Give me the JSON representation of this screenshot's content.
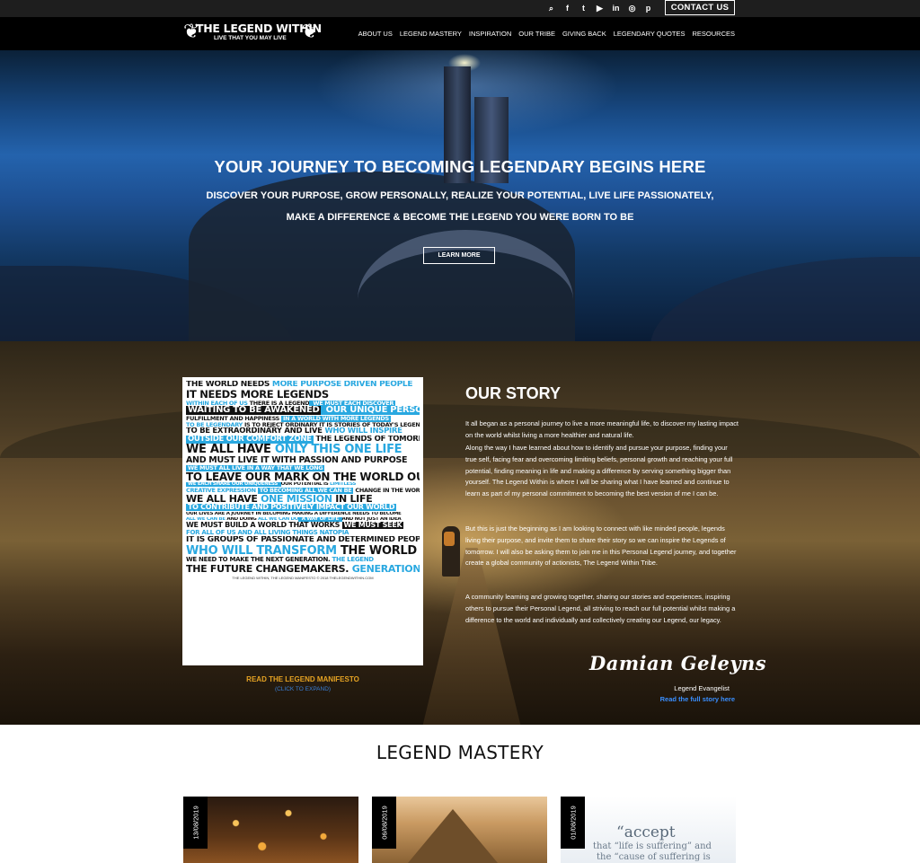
{
  "topbar": {
    "social_icons": [
      "search-icon",
      "facebook-icon",
      "twitter-icon",
      "youtube-icon",
      "linkedin-icon",
      "instagram-icon",
      "pinterest-icon"
    ],
    "social_glyphs": [
      "⌕",
      "f",
      "t",
      "▶",
      "in",
      "◎",
      "p"
    ],
    "contact_label": "CONTACT US"
  },
  "logo": {
    "title": "THE LEGEND WITHIN",
    "tagline": "LIVE THAT YOU MAY LIVE"
  },
  "nav": {
    "items": [
      "ABOUT US",
      "LEGEND MASTERY",
      "INSPIRATION",
      "OUR TRIBE",
      "GIVING BACK",
      "LEGENDARY QUOTES",
      "RESOURCES"
    ]
  },
  "hero": {
    "title": "YOUR JOURNEY TO BECOMING LEGENDARY BEGINS HERE",
    "subtitle_line1": "DISCOVER YOUR PURPOSE, GROW PERSONALLY, REALIZE YOUR POTENTIAL, LIVE LIFE PASSIONATELY,",
    "subtitle_line2": "MAKE A DIFFERENCE & BECOME THE LEGEND YOU WERE BORN TO BE",
    "button_label": "LEARN MORE"
  },
  "manifesto": {
    "lines": [
      [
        {
          "t": "THE WORLD NEEDS ",
          "s": "k"
        },
        {
          "t": "MORE PURPOSE DRIVEN PEOPLE",
          "s": "b"
        }
      ],
      [
        {
          "t": "IT NEEDS MORE LEGENDS",
          "s": "k"
        }
      ],
      [
        {
          "t": "WITHIN EACH OF US ",
          "s": "b"
        },
        {
          "t": "THERE IS A LEGEND",
          "s": "k"
        },
        {
          "t": " WE MUST EACH DISCOVER",
          "s": "binv"
        }
      ],
      [
        {
          "t": "WAITING TO BE AWAKENED",
          "s": "inv"
        },
        {
          "t": " OUR UNIQUE PERSONAL LEGEND",
          "s": "binv"
        }
      ],
      [
        {
          "t": "FULFILLMENT AND HAPPINESS ",
          "s": "k"
        },
        {
          "t": "IN A WORLD WITH MORE LEGENDS",
          "s": "binv"
        }
      ],
      [
        {
          "t": "TO BE LEGENDARY ",
          "s": "b"
        },
        {
          "t": "IS TO REJECT ORDINARY",
          "s": "k"
        },
        {
          "t": " IT IS STORIES OF TODAY'S LEGENDS",
          "s": "k"
        }
      ],
      [
        {
          "t": "TO BE EXTRAORDINARY AND LIVE ",
          "s": "k"
        },
        {
          "t": "WHO WILL INSPIRE",
          "s": "b"
        }
      ],
      [
        {
          "t": "OUTSIDE OUR COMFORT ZONE",
          "s": "binv"
        },
        {
          "t": " THE LEGENDS OF TOMORROW",
          "s": "k"
        }
      ],
      [
        {
          "t": "WE ALL HAVE ",
          "s": "k"
        },
        {
          "t": "ONLY THIS ONE LIFE",
          "s": "b"
        }
      ],
      [
        {
          "t": "AND MUST LIVE IT WITH PASSION AND PURPOSE",
          "s": "k"
        }
      ],
      [
        {
          "t": "WE MUST ALL LIVE IN A WAY THAT WE LONG",
          "s": "binv"
        }
      ],
      [
        {
          "t": "TO LEAVE OUR MARK ON THE WORLD ",
          "s": "k"
        },
        {
          "t": "OUR LEGACY",
          "s": "k"
        }
      ],
      [
        {
          "t": "WE EACH SHARE OUR UNIQUENESS ",
          "s": "binv"
        },
        {
          "t": "OUR POTENTIAL IS ",
          "s": "k"
        },
        {
          "t": "LIMITLESS",
          "s": "b"
        }
      ],
      [
        {
          "t": "CREATIVE EXPRESSION ",
          "s": "b"
        },
        {
          "t": "TO BECOMING ALL WE CAN BE",
          "s": "binv"
        },
        {
          "t": " CHANGE IN THE WORLD",
          "s": "k"
        }
      ],
      [
        {
          "t": "WE ALL HAVE ",
          "s": "k"
        },
        {
          "t": "ONE MISSION",
          "s": "b"
        },
        {
          "t": " IN LIFE",
          "s": "k"
        }
      ],
      [
        {
          "t": "TO CONTRIBUTE AND POSITIVELY IMPACT OUR WORLD",
          "s": "binv"
        }
      ],
      [
        {
          "t": "OUR LIVES ARE A JOURNEY IN BECOMING ",
          "s": "k"
        },
        {
          "t": "MAKING A DIFFERENCE NEEDS TO BECOME",
          "s": "k"
        }
      ],
      [
        {
          "t": "ALL WE CAN BE ",
          "s": "b"
        },
        {
          "t": "AND DOING ",
          "s": "k"
        },
        {
          "t": "ALL WE CAN DO",
          "s": "b"
        },
        {
          "t": " A WAY OF LIFE ",
          "s": "binv"
        },
        {
          "t": "AND NOT JUST AN IDEA",
          "s": "k"
        }
      ],
      [
        {
          "t": "WE MUST BUILD A WORLD THAT WORKS ",
          "s": "k"
        },
        {
          "t": "WE MUST SEEK",
          "s": "inv"
        }
      ],
      [
        {
          "t": "FOR ALL OF US AND ALL LIVING THINGS ",
          "s": "b"
        },
        {
          "t": "NATOPIA",
          "s": "b"
        }
      ],
      [
        {
          "t": "IT IS GROUPS OF PASSIONATE AND DETERMINED PEOPLE",
          "s": "k"
        }
      ],
      [
        {
          "t": "WHO WILL TRANSFORM ",
          "s": "b"
        },
        {
          "t": "THE WORLD",
          "s": "k"
        }
      ],
      [
        {
          "t": "WE NEED TO MAKE THE NEXT GENERATION. ",
          "s": "k"
        },
        {
          "t": "THE LEGEND",
          "s": "b"
        }
      ],
      [
        {
          "t": "THE FUTURE CHANGEMAKERS. ",
          "s": "k"
        },
        {
          "t": "GENERATION",
          "s": "b"
        }
      ]
    ],
    "footer": "THE LEGEND WITHIN, THE LEGEND MANIFESTO © 2018 THELEGENDWITHIN.COM",
    "link_label": "READ THE LEGEND MANIFESTO",
    "expand_label": "(CLICK TO EXPAND)"
  },
  "story": {
    "title": "OUR STORY",
    "p1": "It all began as a personal journey to live a more meaningful life, to discover my lasting impact on the world whilst living a more healthier and natural life.",
    "p2": "Along the way I have learned about how to identify and pursue your purpose, finding your true self, facing fear and overcoming limiting beliefs, personal growth and reaching your full potential, finding meaning in life and making a difference by serving something bigger than yourself. The Legend Within is where I will be sharing what I have learned and continue to learn as part of my personal commitment to becoming the best version of me I can be.",
    "p3": "But this is just the beginning as I am looking to connect with like minded people, legends living their purpose, and invite them to share their story so we can inspire the Legends of tomorrow.  I will also be asking them to join me in this Personal Legend journey, and together create a global community of actionists, The Legend Within Tribe.",
    "p4": "A community learning and growing together, sharing our stories and experiences, inspiring others to pursue their Personal Legend, all striving to reach our full potential whilst making a difference to the world and individually and collectively creating our Legend, our legacy.",
    "signature": "Damian Geleyns",
    "role": "Legend Evangelist",
    "full_story_link": "Read the full story here"
  },
  "mastery": {
    "title": "LEGEND MASTERY",
    "cards": [
      {
        "date": "13/08/2019"
      },
      {
        "date": "06/08/2019"
      },
      {
        "date": "01/08/2019",
        "quote_word": "“accept",
        "quote_line2": "that “life is suffering” and",
        "quote_line3": "the “cause of suffering is"
      }
    ]
  }
}
